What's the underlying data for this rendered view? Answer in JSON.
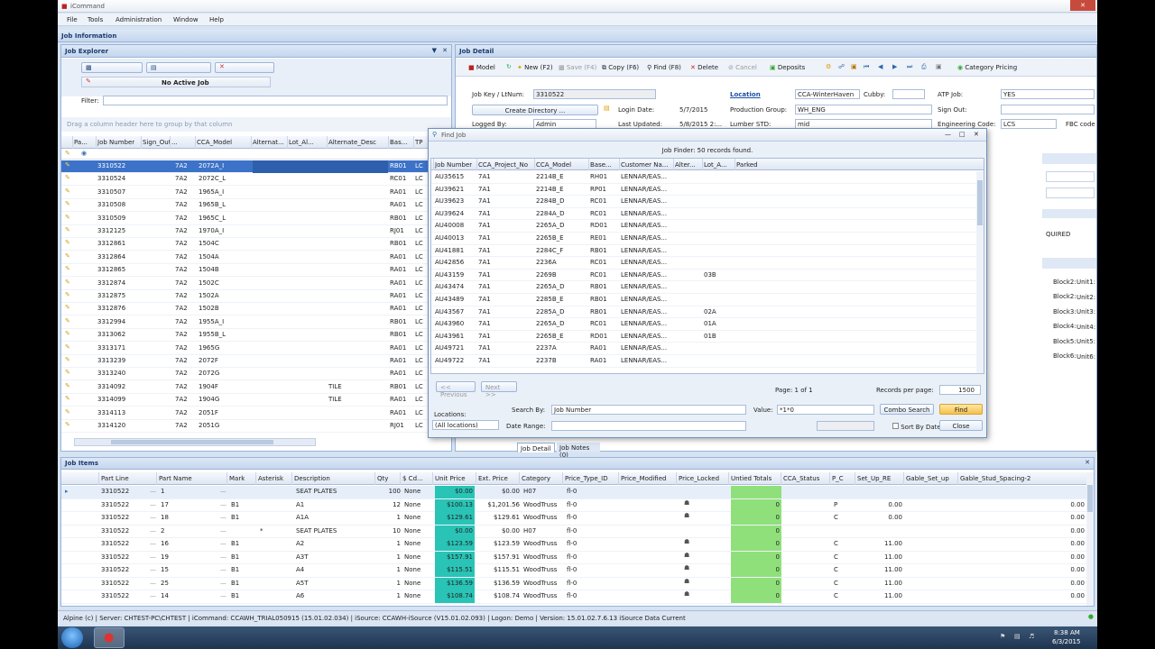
{
  "window": {
    "title": "iCommand"
  },
  "menu": [
    "File",
    "Tools",
    "Administration",
    "Window",
    "Help"
  ],
  "job_information": {
    "title": "Job Information"
  },
  "job_explorer": {
    "title": "Job Explorer",
    "active_job": "No Active Job",
    "filter_label": "Filter:",
    "group_hint": "Drag a column header here to group by that column",
    "columns": [
      "Pa...",
      "Job Number",
      "Sign_Out",
      "...",
      "CCA_Model",
      "Alternat...",
      "Lot_Al...",
      "Alternate_Desc",
      "Bas...",
      "TP"
    ],
    "rows": [
      {
        "job": "3310522",
        "sign": "7A2",
        "model": "2072A_I",
        "alt": "",
        "base": "RB01",
        "tp": "LC"
      },
      {
        "job": "3310524",
        "sign": "7A2",
        "model": "2072C_L",
        "alt": "",
        "base": "RC01",
        "tp": "LC"
      },
      {
        "job": "3310507",
        "sign": "7A2",
        "model": "1965A_I",
        "alt": "",
        "base": "RA01",
        "tp": "LC"
      },
      {
        "job": "3310508",
        "sign": "7A2",
        "model": "1965B_L",
        "alt": "",
        "base": "RA01",
        "tp": "LC"
      },
      {
        "job": "3310509",
        "sign": "7A2",
        "model": "1965C_L",
        "alt": "",
        "base": "RB01",
        "tp": "LC"
      },
      {
        "job": "3312125",
        "sign": "7A2",
        "model": "1970A_I",
        "alt": "",
        "base": "RJ01",
        "tp": "LC"
      },
      {
        "job": "3312861",
        "sign": "7A2",
        "model": "1504C",
        "alt": "",
        "base": "RB01",
        "tp": "LC"
      },
      {
        "job": "3312864",
        "sign": "7A2",
        "model": "1504A",
        "alt": "",
        "base": "RA01",
        "tp": "LC"
      },
      {
        "job": "3312865",
        "sign": "7A2",
        "model": "1504B",
        "alt": "",
        "base": "RA01",
        "tp": "LC"
      },
      {
        "job": "3312874",
        "sign": "7A2",
        "model": "1502C",
        "alt": "",
        "base": "RA01",
        "tp": "LC"
      },
      {
        "job": "3312875",
        "sign": "7A2",
        "model": "1502A",
        "alt": "",
        "base": "RA01",
        "tp": "LC"
      },
      {
        "job": "3312876",
        "sign": "7A2",
        "model": "1502B",
        "alt": "",
        "base": "RA01",
        "tp": "LC"
      },
      {
        "job": "3312994",
        "sign": "7A2",
        "model": "1955A_I",
        "alt": "",
        "base": "RB01",
        "tp": "LC"
      },
      {
        "job": "3313062",
        "sign": "7A2",
        "model": "1955B_L",
        "alt": "",
        "base": "RB01",
        "tp": "LC"
      },
      {
        "job": "3313171",
        "sign": "7A2",
        "model": "1965G",
        "alt": "",
        "base": "RA01",
        "tp": "LC"
      },
      {
        "job": "3313239",
        "sign": "7A2",
        "model": "2072F",
        "alt": "",
        "base": "RA01",
        "tp": "LC"
      },
      {
        "job": "3313240",
        "sign": "7A2",
        "model": "2072G",
        "alt": "",
        "base": "RA01",
        "tp": "LC"
      },
      {
        "job": "3314092",
        "sign": "7A2",
        "model": "1904F",
        "alt": "TILE",
        "base": "RB01",
        "tp": "LC"
      },
      {
        "job": "3314099",
        "sign": "7A2",
        "model": "1904G",
        "alt": "TILE",
        "base": "RA01",
        "tp": "LC"
      },
      {
        "job": "3314113",
        "sign": "7A2",
        "model": "2051F",
        "alt": "",
        "base": "RA01",
        "tp": "LC"
      },
      {
        "job": "3314120",
        "sign": "7A2",
        "model": "2051G",
        "alt": "",
        "base": "RJ01",
        "tp": "LC"
      }
    ]
  },
  "job_detail": {
    "title": "Job Detail",
    "toolbar": [
      "Model",
      "New (F2)",
      "Save (F4)",
      "Copy (F6)",
      "Find (F8)",
      "Delete",
      "Cancel",
      "Deposits",
      "Category Pricing"
    ],
    "jobkey_label": "Job Key / LtNum:",
    "jobkey_value": "3310522",
    "create_dir": "Create Directory ...",
    "logged_by_label": "Logged By:",
    "logged_by_value": "Admin",
    "location_label": "Location",
    "location_value": "CCA-WinterHaven",
    "cubby_label": "Cubby:",
    "atp_label": "ATP Job:",
    "atp_value": "YES",
    "login_date_label": "Login Date:",
    "login_date_value": "5/7/2015",
    "prod_group_label": "Production Group:",
    "prod_group_value": "WH_ENG",
    "signout_label": "Sign Out:",
    "last_updated_label": "Last Updated:",
    "last_updated_value": "5/8/2015 2:...",
    "lumber_label": "Lumber STD:",
    "lumber_value": "mid",
    "eng_code_label": "Engineering Code:",
    "eng_code_value": "LCS",
    "fbc_label": "FBC code",
    "required_text": "QUIRED",
    "blocks": [
      "Block2:",
      "Block3:",
      "Block4:",
      "Block5:",
      "Block6:"
    ],
    "units": [
      "Unit1:",
      "Unit2:",
      "Unit3:",
      "Unit4:",
      "Unit5:",
      "Unit6:"
    ],
    "block1": "Block2:",
    "tabs": [
      "Job Detail",
      "Job Notes (0)"
    ]
  },
  "find_job": {
    "title": "Find Job",
    "status": "Job Finder: 50 records found.",
    "columns": [
      "Job Number",
      "CCA_Project_No",
      "CCA_Model",
      "Base...",
      "Customer Na...",
      "Alter...",
      "Lot_A...",
      "Parked"
    ],
    "rows": [
      {
        "job": "AU35615",
        "proj": "7A1",
        "model": "2214B_E",
        "base": "RH01",
        "cust": "LENNAR/EAS...",
        "lot": ""
      },
      {
        "job": "AU39621",
        "proj": "7A1",
        "model": "2214B_E",
        "base": "RP01",
        "cust": "LENNAR/EAS...",
        "lot": ""
      },
      {
        "job": "AU39623",
        "proj": "7A1",
        "model": "2284B_D",
        "base": "RC01",
        "cust": "LENNAR/EAS...",
        "lot": ""
      },
      {
        "job": "AU39624",
        "proj": "7A1",
        "model": "2284A_D",
        "base": "RC01",
        "cust": "LENNAR/EAS...",
        "lot": ""
      },
      {
        "job": "AU40008",
        "proj": "7A1",
        "model": "2265A_D",
        "base": "RD01",
        "cust": "LENNAR/EAS...",
        "lot": ""
      },
      {
        "job": "AU40013",
        "proj": "7A1",
        "model": "2265B_E",
        "base": "RE01",
        "cust": "LENNAR/EAS...",
        "lot": ""
      },
      {
        "job": "AU41881",
        "proj": "7A1",
        "model": "2284C_F",
        "base": "RB01",
        "cust": "LENNAR/EAS...",
        "lot": ""
      },
      {
        "job": "AU42856",
        "proj": "7A1",
        "model": "2236A",
        "base": "RC01",
        "cust": "LENNAR/EAS...",
        "lot": ""
      },
      {
        "job": "AU43159",
        "proj": "7A1",
        "model": "2269B",
        "base": "RC01",
        "cust": "LENNAR/EAS...",
        "lot": "03B"
      },
      {
        "job": "AU43474",
        "proj": "7A1",
        "model": "2265A_D",
        "base": "RB01",
        "cust": "LENNAR/EAS...",
        "lot": ""
      },
      {
        "job": "AU43489",
        "proj": "7A1",
        "model": "2285B_E",
        "base": "RB01",
        "cust": "LENNAR/EAS...",
        "lot": ""
      },
      {
        "job": "AU43567",
        "proj": "7A1",
        "model": "2285A_D",
        "base": "RB01",
        "cust": "LENNAR/EAS...",
        "lot": "02A"
      },
      {
        "job": "AU43960",
        "proj": "7A1",
        "model": "2265A_D",
        "base": "RC01",
        "cust": "LENNAR/EAS...",
        "lot": "01A"
      },
      {
        "job": "AU43961",
        "proj": "7A1",
        "model": "2265B_E",
        "base": "RD01",
        "cust": "LENNAR/EAS...",
        "lot": "01B"
      },
      {
        "job": "AU49721",
        "proj": "7A1",
        "model": "2237A",
        "base": "RA01",
        "cust": "LENNAR/EAS...",
        "lot": ""
      },
      {
        "job": "AU49722",
        "proj": "7A1",
        "model": "2237B",
        "base": "RA01",
        "cust": "LENNAR/EAS...",
        "lot": ""
      }
    ],
    "previous": "<< Previous",
    "next": "Next >>",
    "page_info": "Page: 1 of 1",
    "records_per_page_label": "Records per page:",
    "records_per_page_value": "1500",
    "locations_label": "Locations:",
    "locations_value": "(All locations)",
    "search_by_label": "Search By:",
    "search_by_value": "Job Number",
    "value_label": "Value:",
    "value_value": "*1*0",
    "date_range_label": "Date Range:",
    "combo_search": "Combo Search",
    "find": "Find",
    "close": "Close",
    "sort_by_date": "Sort By Date"
  },
  "job_items": {
    "title": "Job Items",
    "columns": [
      "Part Line",
      "Part Name",
      "Mark",
      "Asterisk",
      "Description",
      "Qty",
      "$ Cd...",
      "Unit Price",
      "Ext. Price",
      "Category",
      "Price_Type_ID",
      "Price_Modified",
      "Price_Locked",
      "Untied Totals",
      "CCA_Status",
      "P_C",
      "Set_Up_RE",
      "Gable_Set_up",
      "Gable_Stud_Spacing-2"
    ],
    "rows": [
      {
        "line": "3310522",
        "name": "1",
        "mark": "",
        "ast": "",
        "desc": "SEAT PLATES",
        "qty": "100",
        "cd": "None",
        "unit": "$0.00",
        "ext": "$0.00",
        "cat": "H07",
        "pt": "fl-0",
        "locked": false,
        "untied": "",
        "pc": "",
        "setup": "",
        "gss": ""
      },
      {
        "line": "3310522",
        "name": "17",
        "mark": "B1",
        "ast": "",
        "desc": "A1",
        "qty": "12",
        "cd": "None",
        "unit": "$100.13",
        "ext": "$1,201.56",
        "cat": "WoodTruss",
        "pt": "fl-0",
        "locked": true,
        "untied": "0",
        "pc": "P",
        "setup": "0.00",
        "gss": "0.00"
      },
      {
        "line": "3310522",
        "name": "18",
        "mark": "B1",
        "ast": "",
        "desc": "A1A",
        "qty": "1",
        "cd": "None",
        "unit": "$129.61",
        "ext": "$129.61",
        "cat": "WoodTruss",
        "pt": "fl-0",
        "locked": true,
        "untied": "0",
        "pc": "C",
        "setup": "0.00",
        "gss": "0.00"
      },
      {
        "line": "3310522",
        "name": "2",
        "mark": "",
        "ast": "*",
        "desc": "SEAT PLATES",
        "qty": "10",
        "cd": "None",
        "unit": "$0.00",
        "ext": "$0.00",
        "cat": "H07",
        "pt": "fl-0",
        "locked": false,
        "untied": "0",
        "pc": "",
        "setup": "",
        "gss": "0.00"
      },
      {
        "line": "3310522",
        "name": "16",
        "mark": "B1",
        "ast": "",
        "desc": "A2",
        "qty": "1",
        "cd": "None",
        "unit": "$123.59",
        "ext": "$123.59",
        "cat": "WoodTruss",
        "pt": "fl-0",
        "locked": true,
        "untied": "0",
        "pc": "C",
        "setup": "11.00",
        "gss": "0.00"
      },
      {
        "line": "3310522",
        "name": "19",
        "mark": "B1",
        "ast": "",
        "desc": "A3T",
        "qty": "1",
        "cd": "None",
        "unit": "$157.91",
        "ext": "$157.91",
        "cat": "WoodTruss",
        "pt": "fl-0",
        "locked": true,
        "untied": "0",
        "pc": "C",
        "setup": "11.00",
        "gss": "0.00"
      },
      {
        "line": "3310522",
        "name": "15",
        "mark": "B1",
        "ast": "",
        "desc": "A4",
        "qty": "1",
        "cd": "None",
        "unit": "$115.51",
        "ext": "$115.51",
        "cat": "WoodTruss",
        "pt": "fl-0",
        "locked": true,
        "untied": "0",
        "pc": "C",
        "setup": "11.00",
        "gss": "0.00"
      },
      {
        "line": "3310522",
        "name": "25",
        "mark": "B1",
        "ast": "",
        "desc": "A5T",
        "qty": "1",
        "cd": "None",
        "unit": "$136.59",
        "ext": "$136.59",
        "cat": "WoodTruss",
        "pt": "fl-0",
        "locked": true,
        "untied": "0",
        "pc": "C",
        "setup": "11.00",
        "gss": "0.00"
      },
      {
        "line": "3310522",
        "name": "14",
        "mark": "B1",
        "ast": "",
        "desc": "A6",
        "qty": "1",
        "cd": "None",
        "unit": "$108.74",
        "ext": "$108.74",
        "cat": "WoodTruss",
        "pt": "fl-0",
        "locked": true,
        "untied": "0",
        "pc": "C",
        "setup": "11.00",
        "gss": "0.00"
      }
    ]
  },
  "status_bar": "Alpine (c) | Server: CHTEST-PC\\CHTEST | iCommand: CCAWH_TRIAL050915 (15.01.02.034) | iSource: CCAWH-iSource (V15.01.02.093) | Logon: Demo | Version: 15.01.02.7.6.13 iSource Data Current",
  "taskbar": {
    "time": "8:38 AM",
    "date": "6/3/2015"
  }
}
